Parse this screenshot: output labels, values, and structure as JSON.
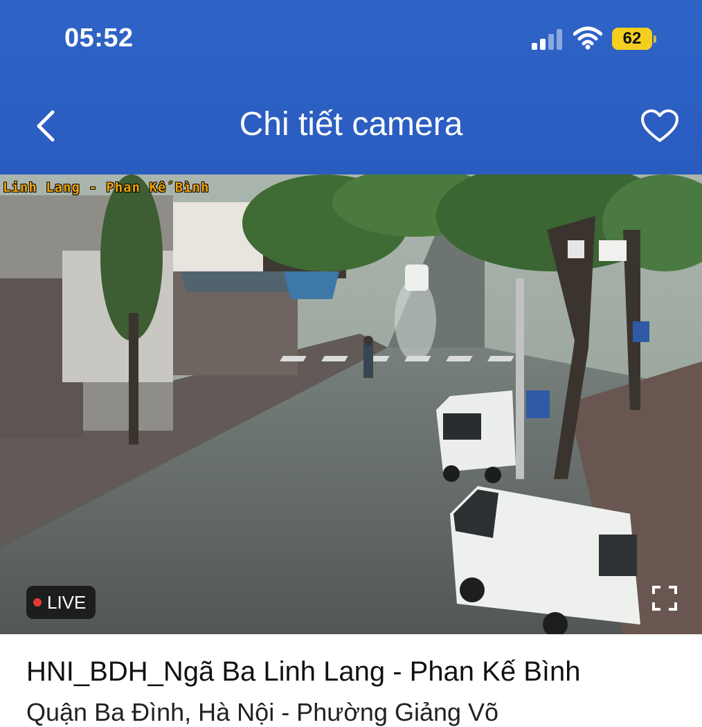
{
  "status_bar": {
    "time": "05:52",
    "battery_level": "62",
    "icons": [
      "signal-icon",
      "wifi-icon",
      "battery-icon"
    ]
  },
  "nav_bar": {
    "title": "Chi tiết camera",
    "back_icon": "chevron-left-icon",
    "favorite_icon": "heart-outline-icon"
  },
  "player": {
    "overlay_caption": "Linh Lang - Phan Kế Bình",
    "live_label": "LIVE",
    "fullscreen_icon": "fullscreen-icon"
  },
  "camera": {
    "name": "HNI_BDH_Ngã Ba Linh Lang - Phan Kế Bình",
    "subtitle": "Quận Ba Đình, Hà Nội - Phường Giảng Võ"
  },
  "colors": {
    "header_blue": "#2b5ec2",
    "battery_yellow": "#f4cf1f",
    "live_dot": "#e53935",
    "caption_orange": "#f0a30a"
  }
}
